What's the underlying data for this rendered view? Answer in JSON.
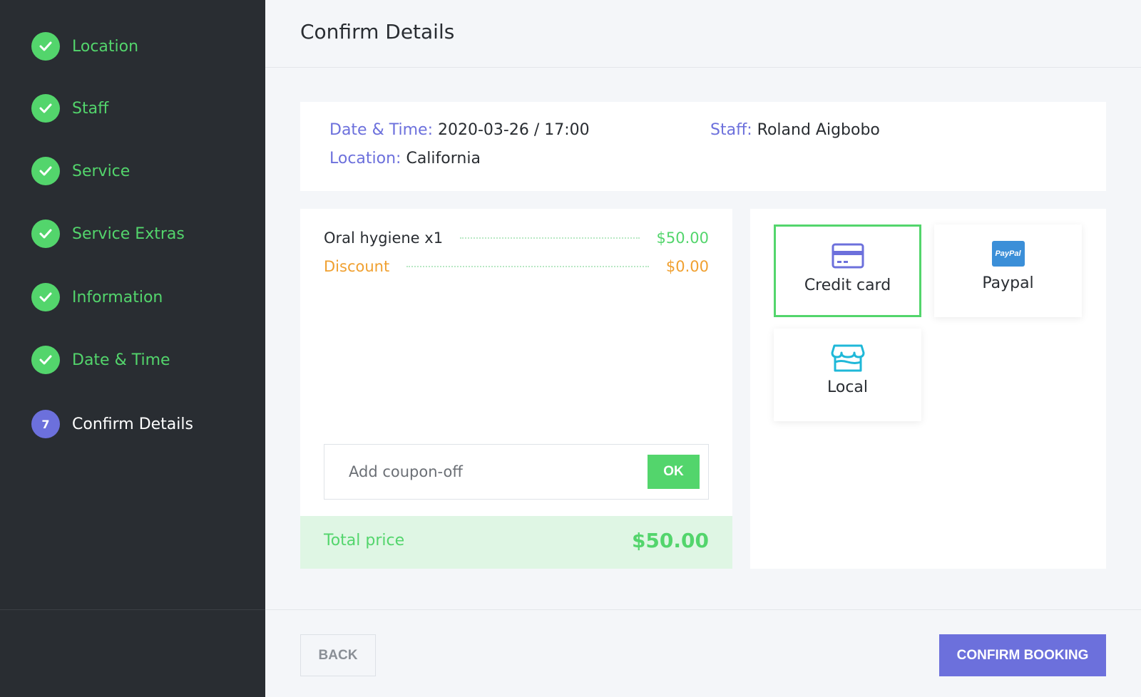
{
  "sidebar": {
    "steps": [
      {
        "label": "Location",
        "status": "done",
        "icon": "check-icon"
      },
      {
        "label": "Staff",
        "status": "done",
        "icon": "check-icon"
      },
      {
        "label": "Service",
        "status": "done",
        "icon": "check-icon"
      },
      {
        "label": "Service Extras",
        "status": "done",
        "icon": "check-icon"
      },
      {
        "label": "Information",
        "status": "done",
        "icon": "check-icon"
      },
      {
        "label": "Date & Time",
        "status": "done",
        "icon": "check-icon"
      },
      {
        "label": "Confirm Details",
        "status": "active",
        "number": "7"
      }
    ]
  },
  "header": {
    "title": "Confirm Details"
  },
  "info": {
    "datetime_label": "Date & Time:",
    "datetime_value": "2020-03-26 / 17:00",
    "staff_label": "Staff:",
    "staff_value": "Roland Aigbobo",
    "location_label": "Location:",
    "location_value": "California"
  },
  "summary": {
    "items": [
      {
        "name": "Oral hygiene x1",
        "price": "$50.00"
      },
      {
        "name": "Discount",
        "price": "$0.00"
      }
    ],
    "coupon": {
      "placeholder": "Add coupon-off",
      "value": "",
      "button_label": "OK"
    },
    "total_label": "Total price",
    "total_value": "$50.00"
  },
  "payment": {
    "options": [
      {
        "label": "Credit card",
        "icon": "credit-card-icon",
        "selected": true
      },
      {
        "label": "Paypal",
        "icon": "paypal-icon",
        "selected": false,
        "icon_text": "PayPal"
      },
      {
        "label": "Local",
        "icon": "store-icon",
        "selected": false
      }
    ]
  },
  "footer": {
    "back_label": "BACK",
    "confirm_label": "CONFIRM BOOKING"
  },
  "colors": {
    "accent": "#6c70dc",
    "success": "#53d56c",
    "discount": "#f0a030",
    "sidebar_bg": "#292d32",
    "page_bg": "#f4f6f9"
  }
}
